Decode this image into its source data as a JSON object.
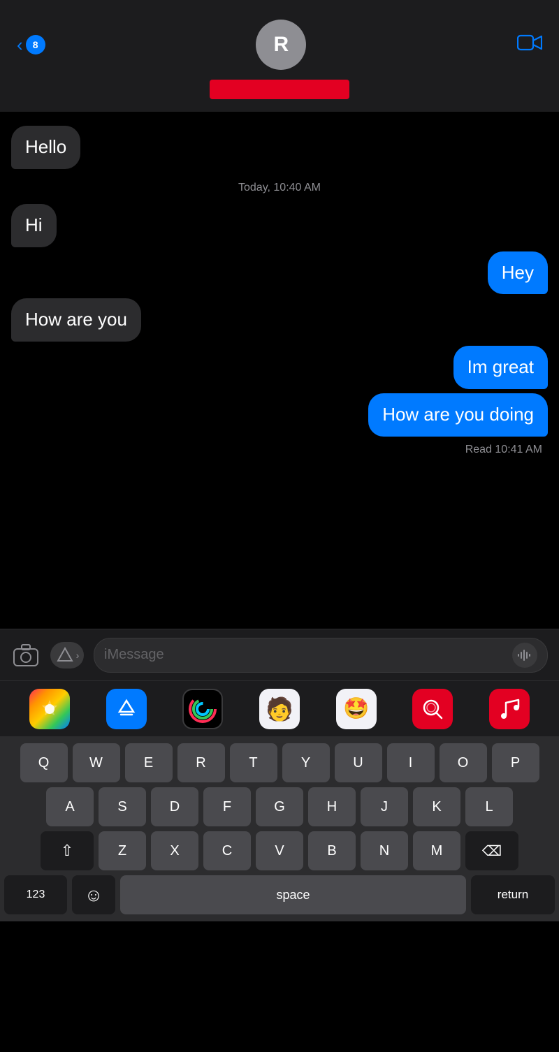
{
  "header": {
    "back_count": "8",
    "avatar_initial": "R",
    "video_label": "video call"
  },
  "messages": [
    {
      "id": 1,
      "type": "received",
      "text": "Hello"
    },
    {
      "id": 2,
      "type": "timestamp",
      "text": "Today, 10:40 AM"
    },
    {
      "id": 3,
      "type": "received",
      "text": "Hi"
    },
    {
      "id": 4,
      "type": "sent",
      "text": "Hey"
    },
    {
      "id": 5,
      "type": "received",
      "text": "How are you"
    },
    {
      "id": 6,
      "type": "sent",
      "text": "Im great"
    },
    {
      "id": 7,
      "type": "sent",
      "text": "How are you doing"
    }
  ],
  "read_receipt": "Read 10:41 AM",
  "input": {
    "placeholder": "iMessage"
  },
  "app_strip": [
    {
      "name": "Photos",
      "type": "photos"
    },
    {
      "name": "App Store",
      "type": "appstore"
    },
    {
      "name": "Fitness",
      "type": "fitness"
    },
    {
      "name": "Memoji",
      "type": "memoji"
    },
    {
      "name": "Emoji Art",
      "type": "emoji-art"
    },
    {
      "name": "Browser",
      "type": "browser"
    },
    {
      "name": "Music",
      "type": "music"
    }
  ],
  "keyboard": {
    "rows": [
      [
        "Q",
        "W",
        "E",
        "R",
        "T",
        "Y",
        "U",
        "I",
        "O",
        "P"
      ],
      [
        "A",
        "S",
        "D",
        "F",
        "G",
        "H",
        "J",
        "K",
        "L"
      ],
      [
        "Z",
        "X",
        "C",
        "V",
        "B",
        "N",
        "M"
      ]
    ],
    "bottom": [
      "123",
      "emoji",
      "space",
      "return"
    ],
    "space_label": "space",
    "return_label": "return",
    "num_label": "123"
  }
}
